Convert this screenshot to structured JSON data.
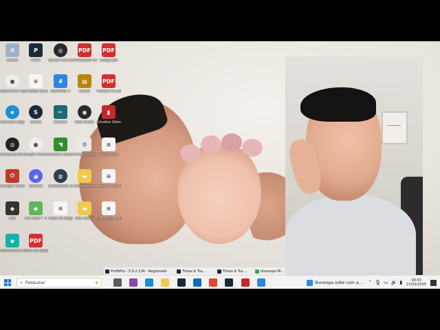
{
  "desktop_icons": [
    {
      "label": "Lixeira",
      "icon": "recycle-bin-icon",
      "color": "#9ab3c9",
      "glyph": "♻"
    },
    {
      "label": "Profit",
      "icon": "profit-icon",
      "color": "#1b2a3a",
      "glyph": "P"
    },
    {
      "label": "Ubisoft Connect",
      "icon": "ubisoft-icon",
      "color": "#2a2a2a",
      "glyph": "◎"
    },
    {
      "label": "FORMAÇÃO INTEGRADA…",
      "icon": "pdf-icon",
      "color": "#d32f2f",
      "glyph": "PDF"
    },
    {
      "label": "codigo.pdf",
      "icon": "pdf-icon",
      "color": "#d32f2f",
      "glyph": "PDF"
    },
    {
      "label": "Aplicativos Instalados",
      "icon": "chrome-icon",
      "color": "#eeeeee",
      "glyph": "●"
    },
    {
      "label": "Template para TCC…",
      "icon": "document-icon",
      "color": "#f5f5f5",
      "glyph": "≡"
    },
    {
      "label": "BetMinds 4",
      "icon": "betminds-icon",
      "color": "#2e86de",
      "glyph": "4"
    },
    {
      "label": "casadi",
      "icon": "winrar-icon",
      "color": "#b8860b",
      "glyph": "▤"
    },
    {
      "label": "relatório 01.pdf",
      "icon": "pdf-icon",
      "color": "#d32f2f",
      "glyph": "PDF"
    },
    {
      "label": "Microsoft Edge",
      "icon": "edge-icon",
      "color": "#1a8fd6",
      "glyph": "e"
    },
    {
      "label": "Steam",
      "icon": "steam-icon",
      "color": "#1b2838",
      "glyph": "S"
    },
    {
      "label": "Shotcut",
      "icon": "shotcut-icon",
      "color": "#1c6a74",
      "glyph": "✂"
    },
    {
      "label": "OBS Studio",
      "icon": "obs-icon",
      "color": "#2a2a2a",
      "glyph": "◉"
    },
    {
      "label": "Estudios Odonto",
      "icon": "folder-icon",
      "color": "#c62828",
      "glyph": "▮"
    },
    {
      "label": "Samsung DeX Web Client",
      "icon": "dex-icon",
      "color": "#222222",
      "glyph": "◎"
    },
    {
      "label": "Google Chrome",
      "icon": "chrome-icon",
      "color": "#eeeeee",
      "glyph": "●"
    },
    {
      "label": "GeForce Experience",
      "icon": "geforce-icon",
      "color": "#2f8f2f",
      "glyph": "◥"
    },
    {
      "label": "Format Factory",
      "icon": "format-factory-icon",
      "color": "#e8e8e8",
      "glyph": "⚙"
    },
    {
      "label": "arquivo.txt",
      "icon": "text-file-icon",
      "color": "#f5f5f5",
      "glyph": "≡"
    },
    {
      "label": "Desligar Gerenciador",
      "icon": "shutdown-icon",
      "color": "#c0392b",
      "glyph": "⏻"
    },
    {
      "label": "Discord",
      "icon": "discord-icon",
      "color": "#5865f2",
      "glyph": "◕"
    },
    {
      "label": "Gerenciador Dados Kalo",
      "icon": "vpn-icon",
      "color": "#2c3e50",
      "glyph": "◍"
    },
    {
      "label": "Documentos",
      "icon": "folder-icon",
      "color": "#f2c94c",
      "glyph": "▬"
    },
    {
      "label": "Arquivo Planilha",
      "icon": "text-file-icon",
      "color": "#f5f5f5",
      "glyph": "≡"
    },
    {
      "label": "Soft",
      "icon": "app-icon",
      "color": "#333333",
      "glyph": "◆"
    },
    {
      "label": "The Sims™ 4",
      "icon": "sims-icon",
      "color": "#5cb85c",
      "glyph": "◆"
    },
    {
      "label": "Plano de Negócio",
      "icon": "document-icon",
      "color": "#f5f5f5",
      "glyph": "≡"
    },
    {
      "label": "Meu Diário",
      "icon": "folder-icon",
      "color": "#f2c94c",
      "glyph": "▬"
    },
    {
      "label": "CHECKLIST SEGURANÇA",
      "icon": "document-icon",
      "color": "#f5f5f5",
      "glyph": "≡"
    },
    {
      "label": "Wondershare Filmora 12",
      "icon": "filmora-icon",
      "color": "#12b3a8",
      "glyph": "◆"
    },
    {
      "label": "Plano de Negócio.pdf",
      "icon": "pdf-icon",
      "color": "#d32f2f",
      "glyph": "PDF"
    }
  ],
  "thumbnails": [
    {
      "title": "ProfitPro - 5.0.2.134 - Registrado",
      "icon": "profit-icon",
      "color": "#1b2a3a"
    },
    {
      "title": "Times & Tra…",
      "icon": "profit-icon",
      "color": "#1b2a3a"
    },
    {
      "title": "Times & Tra…",
      "icon": "profit-icon",
      "color": "#1b2a3a"
    },
    {
      "title": "Ibovespa Mi…",
      "icon": "chrome-icon",
      "color": "#34a853"
    }
  ],
  "taskbar": {
    "search_placeholder": "Pesquisar",
    "notification_text": "Ibovespa sobe com a…",
    "time": "09:43",
    "date": "21/02/2025"
  },
  "taskbar_apps": [
    {
      "icon": "task-view-icon",
      "color": "#5a5a5a"
    },
    {
      "icon": "copilot-icon",
      "color": "#8e44ad"
    },
    {
      "icon": "edge-icon",
      "color": "#1a8fd6"
    },
    {
      "icon": "file-explorer-icon",
      "color": "#f2c94c"
    },
    {
      "icon": "profit-icon",
      "color": "#1b2a3a"
    },
    {
      "icon": "outlook-icon",
      "color": "#0f6cbd"
    },
    {
      "icon": "chrome-icon",
      "color": "#ea4335"
    },
    {
      "icon": "profit-icon",
      "color": "#1b2a3a"
    },
    {
      "icon": "ubisoft-icon",
      "color": "#c62828"
    },
    {
      "icon": "network-app-icon",
      "color": "#2e86de"
    }
  ]
}
